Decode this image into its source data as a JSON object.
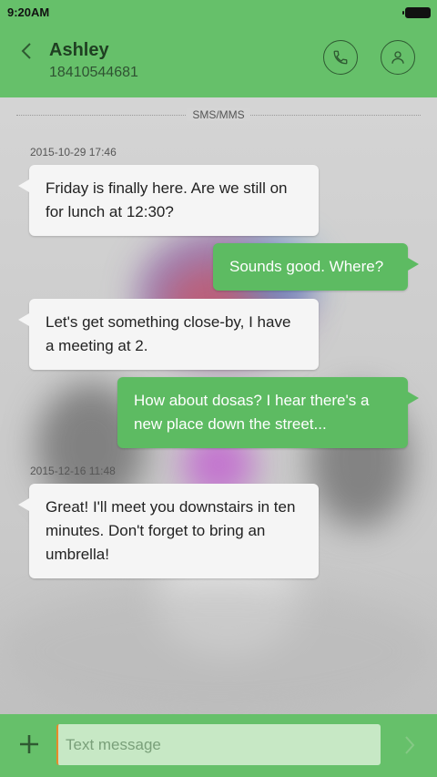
{
  "status_bar": {
    "time": "9:20AM",
    "battery_icon": "battery-icon"
  },
  "header": {
    "back_icon": "chevron-left-icon",
    "contact_name": "Ashley",
    "contact_number": "18410544681",
    "call_icon": "phone-icon",
    "contact_icon": "person-icon"
  },
  "conversation": {
    "channel_label": "SMS/MMS",
    "timestamps": [
      "2015-10-29 17:46",
      "2015-12-16 11:48"
    ],
    "messages": [
      {
        "direction": "incoming",
        "text": "Friday is finally here. Are we still on for lunch at 12:30?"
      },
      {
        "direction": "outgoing",
        "text": "Sounds good. Where?"
      },
      {
        "direction": "incoming",
        "text": "Let's get something close-by, I have a meeting at 2."
      },
      {
        "direction": "outgoing",
        "text": "How about dosas? I hear there's a new place down the street..."
      },
      {
        "direction": "incoming",
        "text": "Great! I'll meet you downstairs in ten minutes. Don't forget to bring an umbrella!"
      }
    ]
  },
  "composer": {
    "add_icon": "plus-icon",
    "placeholder": "Text message",
    "value": "",
    "send_icon": "chevron-right-icon"
  },
  "colors": {
    "accent_green": "#66c06a",
    "outgoing_bubble": "#5dbb62",
    "incoming_bubble": "#f5f5f5"
  }
}
